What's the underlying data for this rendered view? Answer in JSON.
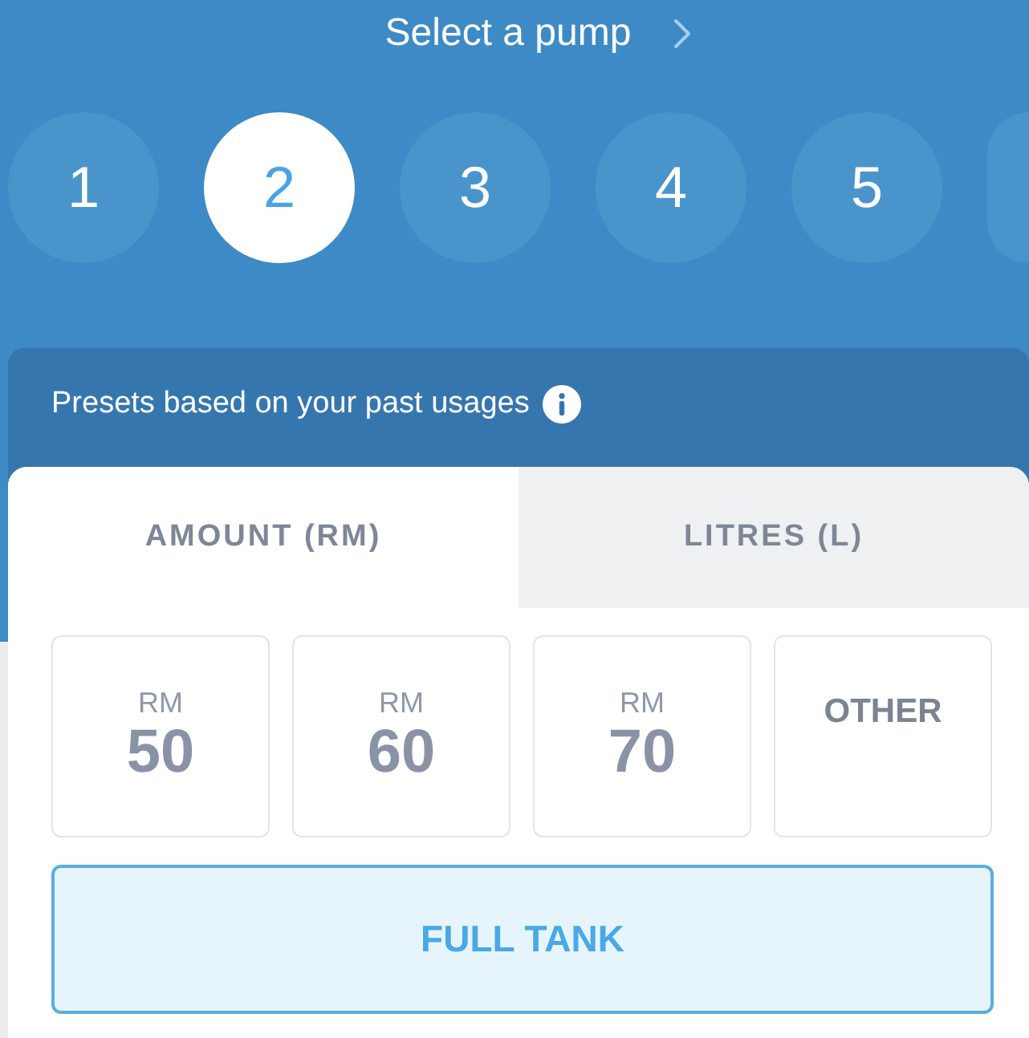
{
  "header": {
    "title": "Select a pump"
  },
  "pumps": [
    {
      "label": "1",
      "selected": false
    },
    {
      "label": "2",
      "selected": true
    },
    {
      "label": "3",
      "selected": false
    },
    {
      "label": "4",
      "selected": false
    },
    {
      "label": "5",
      "selected": false
    }
  ],
  "more_pumps_cut_off": true,
  "presets_panel": {
    "caption": "Presets based on your past usages"
  },
  "tabs": [
    {
      "label": "AMOUNT (RM)",
      "selected": true
    },
    {
      "label": "LITRES (L)",
      "selected": false
    }
  ],
  "presets": [
    {
      "kind": "amount",
      "currency": "RM",
      "value": "50",
      "selected": false
    },
    {
      "kind": "amount",
      "currency": "RM",
      "value": "60",
      "selected": false
    },
    {
      "kind": "amount",
      "currency": "RM",
      "value": "70",
      "selected": false
    },
    {
      "kind": "other",
      "label": "OTHER",
      "selected": false
    }
  ],
  "full_tank": {
    "label": "FULL TANK",
    "selected": true
  }
}
